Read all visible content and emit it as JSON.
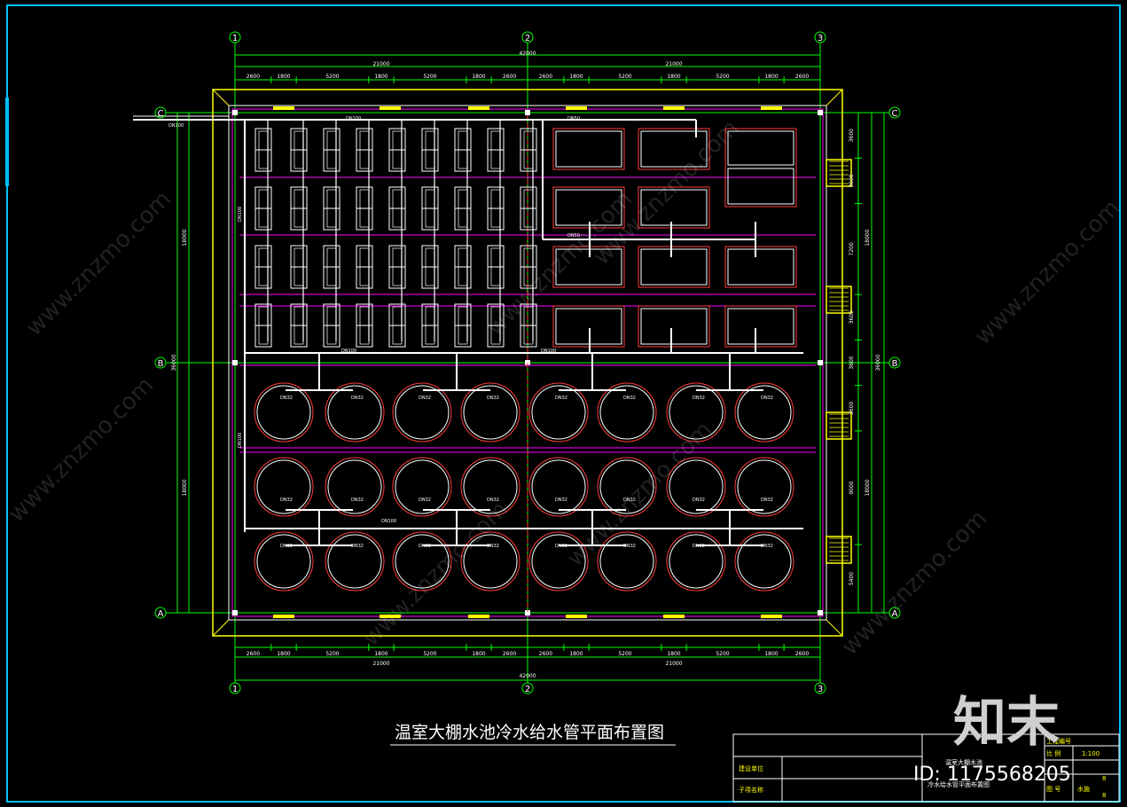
{
  "drawing_title": "温室大棚水池冷水给水管平面布置图",
  "axes": {
    "columns": [
      "1",
      "2",
      "3"
    ],
    "rows": [
      "C",
      "B",
      "A"
    ]
  },
  "dimensions": {
    "total": "42000",
    "half": "21000",
    "segments": [
      "2600",
      "1800",
      "5200",
      "1800",
      "5200",
      "1800",
      "2600",
      "2600",
      "1800",
      "5200",
      "1800",
      "5200",
      "1800",
      "2600"
    ],
    "left_total": "36000",
    "left_parts": [
      "18000",
      "18000"
    ],
    "right_parts": [
      "3600",
      "3600",
      "7200",
      "3600",
      "3600",
      "3600",
      "9000",
      "5400"
    ],
    "right_half": "18000"
  },
  "pipe_labels": {
    "main": "DN100",
    "inlet": "DN100",
    "branch": "DN50",
    "small": "DN25",
    "pool": "DN32",
    "tank": "DN20"
  },
  "title_block": {
    "project_no_label": "工程编号",
    "scale_label": "比 例",
    "scale_value": "1:100",
    "drawing_no_label": "图 号",
    "discipline": "水施",
    "unit_label": "建设单位",
    "item_label": "子项名称",
    "drawing_name_1": "温室大棚水池",
    "drawing_name_2": "冷水给水管平面布置图",
    "sheet_no": "8",
    "sheet_total": "8"
  },
  "watermark": {
    "site": "www.znzmo.com",
    "brand": "知末网",
    "logo": "知末",
    "id": "ID: 1175568205"
  },
  "colors": {
    "background": "#000000",
    "dimension": "#00ff00",
    "wall": "#ffff00",
    "pipe": "#ffffff",
    "pool_outer": "#ff3b3b",
    "grid": "#ff00ff",
    "frame": "#00bfff"
  }
}
